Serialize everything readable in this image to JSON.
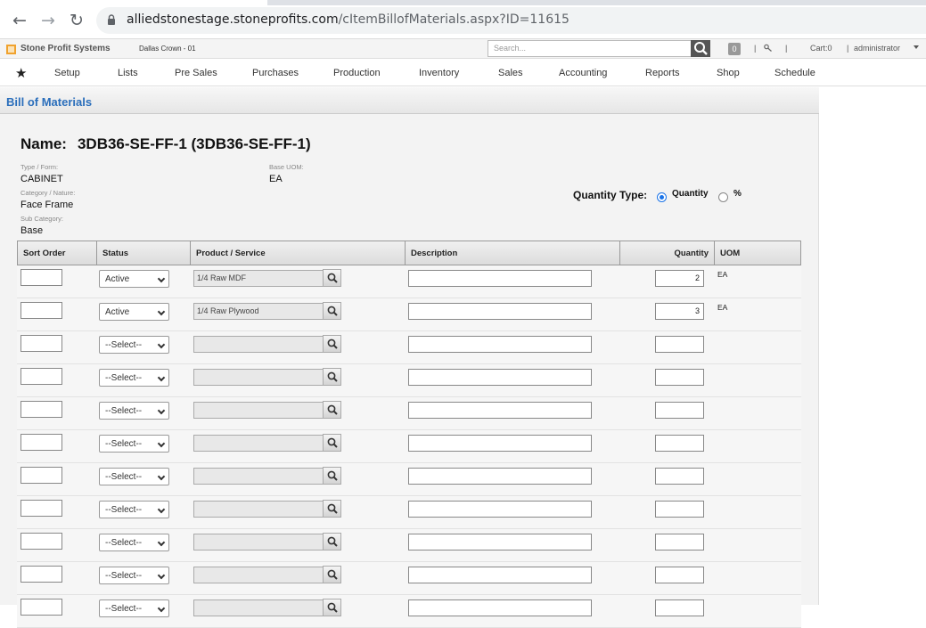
{
  "browser": {
    "url_host": "alliedstonestage.stoneprofits.com",
    "url_path": "/cItemBillofMaterials.aspx?ID=11615"
  },
  "header": {
    "brand": "Stone Profit Systems",
    "location": "Dallas Crown - 01",
    "search_placeholder": "Search...",
    "notifications_count": "0",
    "separator1": "|",
    "separator2": "|",
    "cart": "Cart:0",
    "separator3": "|",
    "user": "administrator"
  },
  "menu": {
    "items": [
      "Setup",
      "Lists",
      "Pre Sales",
      "Purchases",
      "Production",
      "Inventory",
      "Sales",
      "Accounting",
      "Reports",
      "Shop",
      "Schedule"
    ]
  },
  "page": {
    "title": "Bill of Materials",
    "name_label": "Name:",
    "name_value": "3DB36-SE-FF-1 (3DB36-SE-FF-1)",
    "type_label": "Type / Form:",
    "type_value": "CABINET",
    "base_uom_label": "Base UOM:",
    "base_uom_value": "EA",
    "category_label": "Category / Nature:",
    "category_value": "Face Frame",
    "subcategory_label": "Sub Category:",
    "subcategory_value": "Base",
    "quantity_type_label": "Quantity Type:",
    "quantity_type_options": [
      "Quantity",
      "%"
    ],
    "quantity_type_selected": "Quantity"
  },
  "table": {
    "headers": [
      "Sort Order",
      "Status",
      "Product / Service",
      "Description",
      "Quantity",
      "UOM"
    ],
    "rows": [
      {
        "sort": "",
        "status": "Active",
        "product": "1/4 Raw MDF",
        "description": "",
        "quantity": "2",
        "uom": "EA"
      },
      {
        "sort": "",
        "status": "Active",
        "product": "1/4 Raw Plywood",
        "description": "",
        "quantity": "3",
        "uom": "EA"
      },
      {
        "sort": "",
        "status": "--Select--",
        "product": "",
        "description": "",
        "quantity": "",
        "uom": ""
      },
      {
        "sort": "",
        "status": "--Select--",
        "product": "",
        "description": "",
        "quantity": "",
        "uom": ""
      },
      {
        "sort": "",
        "status": "--Select--",
        "product": "",
        "description": "",
        "quantity": "",
        "uom": ""
      },
      {
        "sort": "",
        "status": "--Select--",
        "product": "",
        "description": "",
        "quantity": "",
        "uom": ""
      },
      {
        "sort": "",
        "status": "--Select--",
        "product": "",
        "description": "",
        "quantity": "",
        "uom": ""
      },
      {
        "sort": "",
        "status": "--Select--",
        "product": "",
        "description": "",
        "quantity": "",
        "uom": ""
      },
      {
        "sort": "",
        "status": "--Select--",
        "product": "",
        "description": "",
        "quantity": "",
        "uom": ""
      },
      {
        "sort": "",
        "status": "--Select--",
        "product": "",
        "description": "",
        "quantity": "",
        "uom": ""
      },
      {
        "sort": "",
        "status": "--Select--",
        "product": "",
        "description": "",
        "quantity": "",
        "uom": ""
      }
    ]
  },
  "icons": {
    "back": "back-arrow-icon",
    "forward": "forward-arrow-icon",
    "reload": "reload-icon",
    "lock": "lock-icon",
    "search": "magnifier-icon",
    "favorites": "star-icon"
  },
  "colors": {
    "title_blue": "#2a6ebb",
    "logo_orange": "#f0a22e",
    "radio_blue": "#1a73e8"
  }
}
